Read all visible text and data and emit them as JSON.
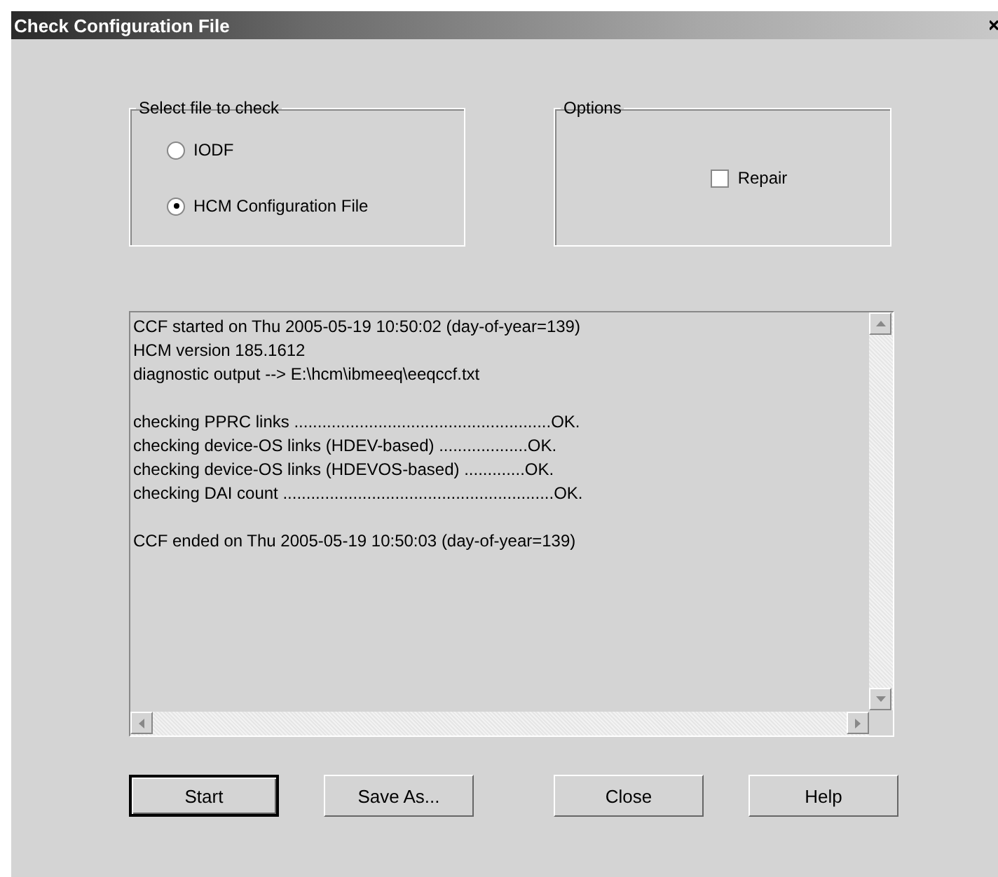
{
  "window": {
    "title": "Check Configuration File"
  },
  "file_group": {
    "label": "Select file to check",
    "options": [
      {
        "label": "IODF",
        "selected": false
      },
      {
        "label": "HCM Configuration File",
        "selected": true
      }
    ]
  },
  "options_group": {
    "label": "Options",
    "checkboxes": [
      {
        "label": "Repair",
        "checked": false
      }
    ]
  },
  "log": {
    "paragraphs": [
      [
        "CCF started on Thu 2005-05-19 10:50:02 (day-of-year=139)",
        "HCM version 185.1612",
        "diagnostic output --> E:\\hcm\\ibmeeq\\eeqccf.txt"
      ],
      [
        "checking PPRC links .......................................................OK.",
        "checking device-OS links (HDEV-based) ...................OK.",
        "checking device-OS links (HDEVOS-based) .............OK.",
        "checking DAI count ..........................................................OK."
      ],
      [
        "CCF ended on Thu 2005-05-19 10:50:03 (day-of-year=139)"
      ]
    ]
  },
  "buttons": [
    {
      "label": "Start",
      "default": true
    },
    {
      "label": "Save As...",
      "default": false
    },
    {
      "label": "Close",
      "default": false
    },
    {
      "label": "Help",
      "default": false
    }
  ]
}
